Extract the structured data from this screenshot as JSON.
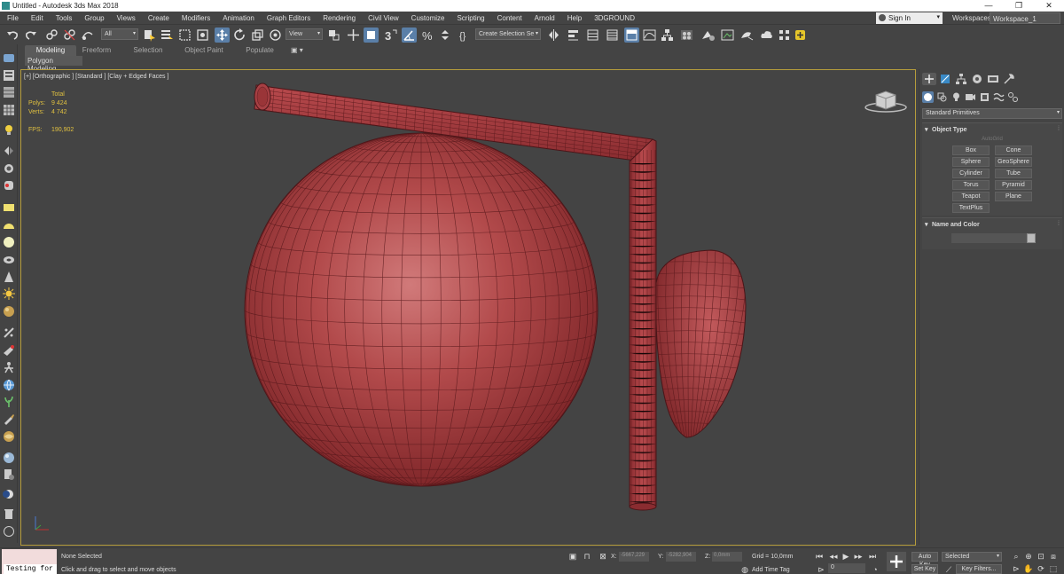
{
  "window": {
    "title": "Untitled - Autodesk 3ds Max 2018",
    "controls": [
      "—",
      "❐",
      "✕"
    ]
  },
  "menu": {
    "items": [
      "File",
      "Edit",
      "Tools",
      "Group",
      "Views",
      "Create",
      "Modifiers",
      "Animation",
      "Graph Editors",
      "Rendering",
      "Civil View",
      "Customize",
      "Scripting",
      "Content",
      "Arnold",
      "Help",
      "3DGROUND"
    ],
    "sign_in": "Sign In",
    "workspaces_label": "Workspaces:",
    "workspace_value": "Workspace_1"
  },
  "toolbar": {
    "filter_value": "All",
    "ref_coord_value": "View",
    "selection_set_value": "Create Selection Se"
  },
  "ribbon": {
    "tabs": [
      "Modeling",
      "Freeform",
      "Selection",
      "Object Paint",
      "Populate"
    ],
    "options": "▣ ▾",
    "sub_label": "Polygon Modeling"
  },
  "viewport": {
    "label": "[+] [Orthographic ] [Standard ] [Clay + Edged Faces ]",
    "stats": {
      "header": "Total",
      "polys_label": "Polys:",
      "polys_value": "9 424",
      "verts_label": "Verts:",
      "verts_value": "4 742",
      "fps_label": "FPS:",
      "fps_value": "190,902"
    },
    "mesh_color": "#a8363a",
    "border_color": "#b59c3c"
  },
  "command_panel": {
    "category_dropdown": "Standard Primitives",
    "object_type": {
      "title": "Object Type",
      "sign": "▾",
      "autogrid": "AutoGrid",
      "buttons": [
        "Box",
        "Cone",
        "Sphere",
        "GeoSphere",
        "Cylinder",
        "Tube",
        "Torus",
        "Pyramid",
        "Teapot",
        "Plane",
        "TextPlus"
      ]
    },
    "name_and_color": {
      "title": "Name and Color",
      "sign": "▾"
    }
  },
  "statusbar": {
    "script_text": "Testing for",
    "selection_status": "None Selected",
    "prompt": "Click and drag to select and move objects",
    "x_label": "X:",
    "x_value": "-5667,229",
    "y_label": "Y:",
    "y_value": "-5282,904",
    "z_label": "Z:",
    "z_value": "0,0mm",
    "grid": "Grid = 10,0mm",
    "add_time_tag": "Add Time Tag",
    "frame": "0",
    "auto_key": "Auto Key",
    "set_key": "Set Key",
    "key_mode": "Selected",
    "key_filters": "Key Filters..."
  }
}
